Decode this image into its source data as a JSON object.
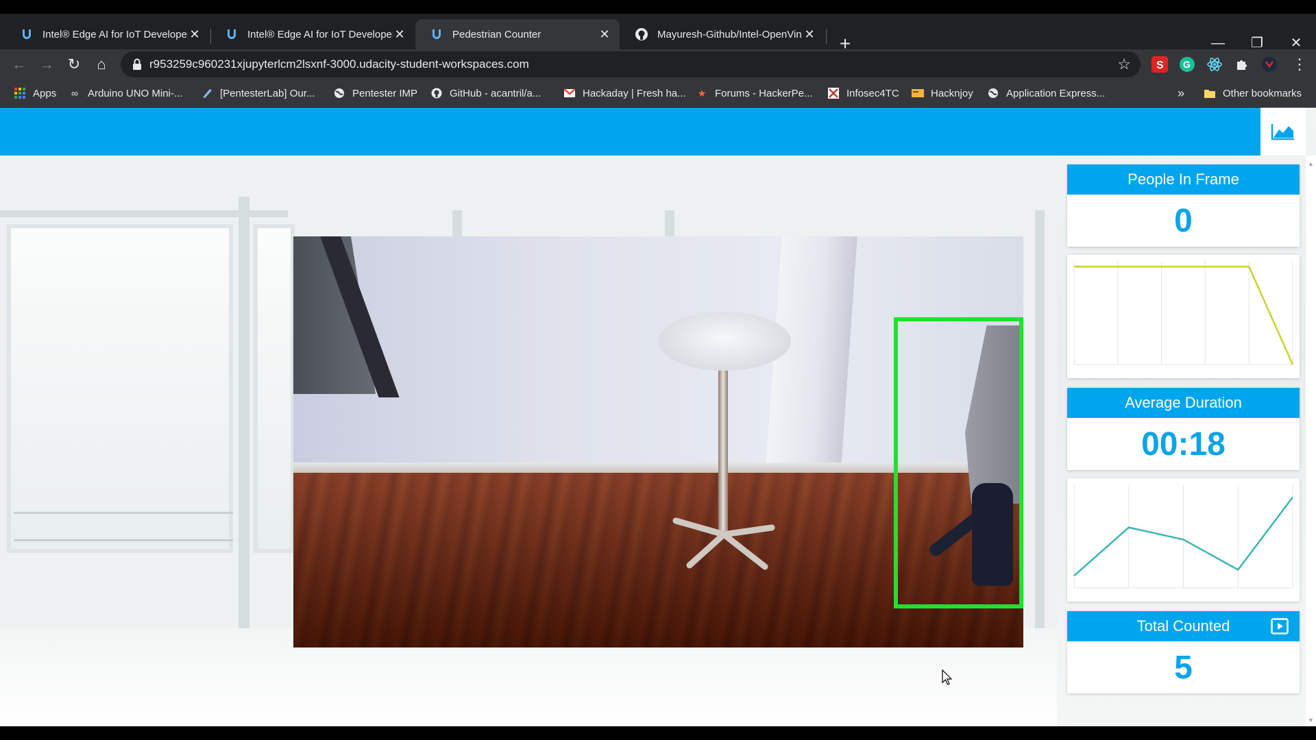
{
  "browser": {
    "tabs": [
      {
        "title": "Intel® Edge AI for IoT Developer",
        "active": false
      },
      {
        "title": "Intel® Edge AI for IoT Developer",
        "active": false
      },
      {
        "title": "Pedestrian Counter",
        "active": true
      },
      {
        "title": "Mayuresh-Github/Intel-OpenVin",
        "active": false
      }
    ],
    "url": "r953259c960231xjupyterlcm2lsxnf-3000.udacity-student-workspaces.com",
    "bookmarks": [
      {
        "label": "Apps",
        "icon": "apps-grid-icon"
      },
      {
        "label": "Arduino UNO Mini-...",
        "icon": "infinity-icon"
      },
      {
        "label": "[PentesterLab] Our...",
        "icon": "pen-icon"
      },
      {
        "label": "Pentester IMP",
        "icon": "globe-icon"
      },
      {
        "label": "GitHub - acantril/a...",
        "icon": "github-icon"
      },
      {
        "label": "Hackaday | Fresh ha...",
        "icon": "gmail-icon"
      },
      {
        "label": "Forums - HackerPe...",
        "icon": "star-icon"
      },
      {
        "label": "Infosec4TC",
        "icon": "shield-icon"
      },
      {
        "label": "Hacknjoy",
        "icon": "card-icon"
      },
      {
        "label": "Application Express...",
        "icon": "globe-icon"
      }
    ],
    "overflow": "»",
    "other_bookmarks": "Other bookmarks"
  },
  "dashboard": {
    "people_in_frame": {
      "label": "People In Frame",
      "value": "0"
    },
    "average_duration": {
      "label": "Average Duration",
      "value": "00:18"
    },
    "total_counted": {
      "label": "Total Counted",
      "value": "5"
    }
  },
  "chart_data": [
    {
      "type": "line",
      "name": "people-in-frame-history",
      "x": [
        0,
        1,
        2,
        3,
        4,
        5
      ],
      "y": [
        1,
        1,
        1,
        1,
        1,
        0
      ],
      "ylim": [
        0,
        1.05
      ],
      "color": "#c8d42a",
      "grid": "vertical"
    },
    {
      "type": "line",
      "name": "average-duration-history",
      "x": [
        0,
        1,
        2,
        3,
        4
      ],
      "y": [
        10,
        18,
        16,
        11,
        23
      ],
      "ylim": [
        8,
        25
      ],
      "color": "#3bb6b4",
      "grid": "vertical"
    }
  ],
  "colors": {
    "header": "#00a5ee",
    "value_text": "#0aa4e8",
    "bbox": "#22e030"
  }
}
